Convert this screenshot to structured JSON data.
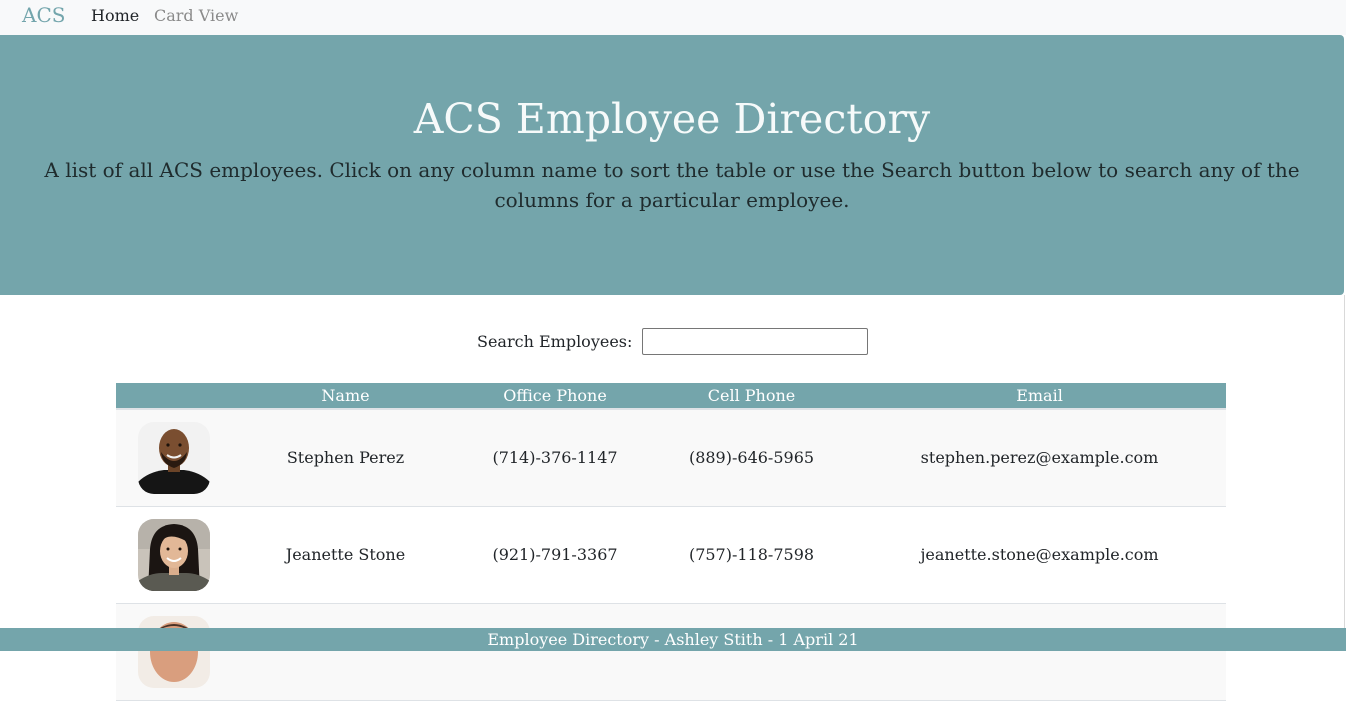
{
  "nav": {
    "brand": "ACS",
    "links": [
      "Home",
      "Card View"
    ]
  },
  "hero": {
    "title": "ACS Employee Directory",
    "description": "A list of all ACS employees. Click on any column name to sort the table or use the Search button below to search any of the columns for a particular employee."
  },
  "search": {
    "label": "Search Employees:",
    "value": ""
  },
  "table": {
    "headers": [
      "",
      "Name",
      "Office Phone",
      "Cell Phone",
      "Email"
    ],
    "rows": [
      {
        "name": "Stephen Perez",
        "office": "(714)-376-1147",
        "cell": "(889)-646-5965",
        "email": "stephen.perez@example.com"
      },
      {
        "name": "Jeanette Stone",
        "office": "(921)-791-3367",
        "cell": "(757)-118-7598",
        "email": "jeanette.stone@example.com"
      },
      {
        "name": "",
        "office": "",
        "cell": "",
        "email": ""
      }
    ]
  },
  "footer": {
    "text": "Employee Directory - Ashley Stith - 1 April 21"
  },
  "colors": {
    "accent": "#74a5ab",
    "navbar": "#f8f9fa"
  }
}
